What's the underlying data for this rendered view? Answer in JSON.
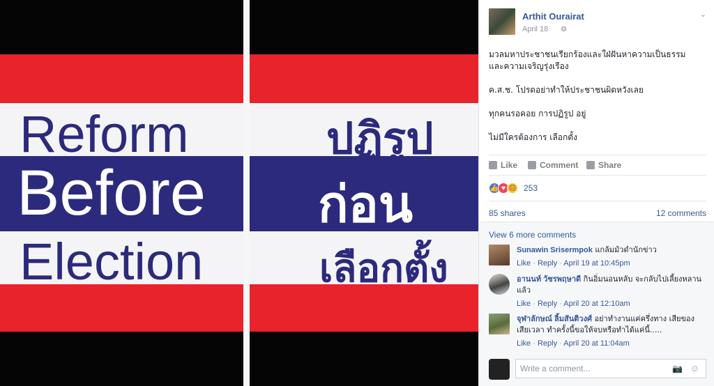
{
  "photo": {
    "english": [
      "Reform",
      "Before",
      "Election"
    ],
    "thai": [
      "ปฏิรูป",
      "ก่อน",
      "เลือกตั้ง"
    ],
    "colors": {
      "red": "#e8232c",
      "white": "#f4f4f6",
      "blue": "#2c2a7c",
      "black": "#050505"
    }
  },
  "post": {
    "author": "Arthit Ourairat",
    "date": "April 18",
    "privacy_icon": "globe-icon",
    "menu_icon": "chevron-down-icon",
    "body": [
      "มวลมหาประชาชนเรียกร้องและใฝ่ฝันหาความเป็นธรรม",
      "และความเจริญรุ่งเรือง",
      "",
      "ค.ส.ช. โปรดอย่าทำให้ประชาชนผิดหวังเลย",
      "",
      "ทุกคนรอคอย การปฏิรูป อยู่",
      "",
      "ไม่มีใครต้องการ เลือกตั้ง"
    ],
    "actions": {
      "like": "Like",
      "comment": "Comment",
      "share": "Share"
    },
    "reaction_count": "253",
    "shares": "85 shares",
    "comments_count": "12 comments"
  },
  "comments": {
    "view_more": "View 6 more comments",
    "items": [
      {
        "name": "Sunawin Srisermpok",
        "text": "แกล้มมัวดำนักข่าว",
        "like": "Like",
        "reply": "Reply",
        "time": "April 19 at 10:45pm"
      },
      {
        "name": "อานนท์ วัชรพฤษาดี",
        "text": "กินอิ่มนอนหลับ จะกลับไปเลี้ยงหลานแล้ว",
        "like": "Like",
        "reply": "Reply",
        "time": "April 20 at 12:10am"
      },
      {
        "name": "จุฬาลักษณ์ ลิ้มสันติวงศ์",
        "text": "อย่าทำงานแค่ครึ่งทาง เสียของ เสียเวลา ทำครั้งนี้ขอให้จบหรือทำได้แค่นี้.....",
        "like": "Like",
        "reply": "Reply",
        "time": "April 20 at 11:04am"
      }
    ],
    "composer_placeholder": "Write a comment...",
    "camera_icon": "camera-icon",
    "emoji_icon": "emoji-icon"
  }
}
